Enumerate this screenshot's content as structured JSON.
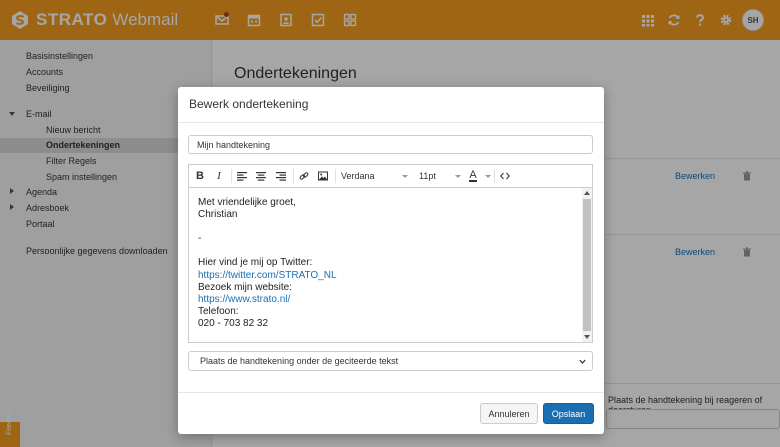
{
  "header": {
    "brand": "STRATO",
    "product": "Webmail",
    "avatar_initials": "SH",
    "icons": [
      "mail-icon",
      "calendar-icon",
      "contacts-icon",
      "tasks-icon",
      "files-icon"
    ],
    "right_icons": [
      "apps-grid-icon",
      "refresh-icon",
      "help-icon",
      "settings-icon"
    ],
    "color": "#f39c1f"
  },
  "sidebar": {
    "items": [
      {
        "label": "Basisinstellingen"
      },
      {
        "label": "Accounts"
      },
      {
        "label": "Beveiliging"
      },
      {
        "label": "E-mail"
      },
      {
        "label": "Nieuw bericht"
      },
      {
        "label": "Ondertekeningen"
      },
      {
        "label": "Filter Regels"
      },
      {
        "label": "Spam instellingen"
      },
      {
        "label": "Agenda"
      },
      {
        "label": "Adresboek"
      },
      {
        "label": "Portaal"
      },
      {
        "label": "Persoonlijke gegevens downloaden"
      }
    ],
    "feedback_label": "Feedback"
  },
  "main": {
    "title": "Ondertekeningen",
    "edit_label": "Bewerken",
    "reply_label": "Plaats de handtekening bij reageren of doorsturen"
  },
  "modal": {
    "title": "Bewerk ondertekening",
    "name_value": "Mijn handtekening",
    "toolbar": {
      "bold": "B",
      "italic": "I",
      "font": "Verdana",
      "size": "11pt",
      "color_letter": "A"
    },
    "signature_lines": [
      "Met vriendelijke groet,",
      "Christian",
      "",
      "-",
      "",
      "Hier vind je mij op Twitter:",
      "https://twitter.com/STRATO_NL",
      "Bezoek mijn website:",
      "https://www.strato.nl/",
      "Telefoon:",
      "020 - 703 82 32"
    ],
    "placement": "Plaats de handtekening onder de geciteerde tekst",
    "cancel_label": "Annuleren",
    "save_label": "Opslaan",
    "accent": "#1a6fb3"
  }
}
